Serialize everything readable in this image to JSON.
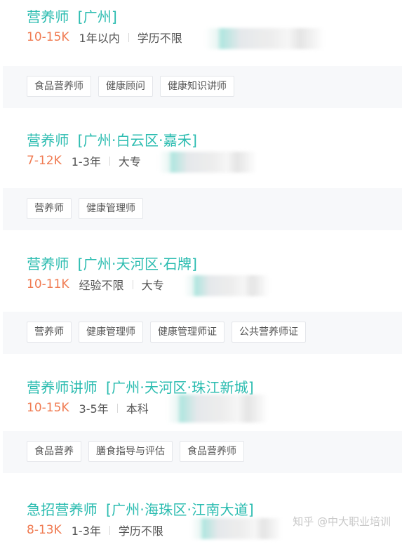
{
  "jobs": [
    {
      "title": "营养师",
      "location": "[广州]",
      "salary": "10-15K",
      "experience": "1年以内",
      "education": "学历不限",
      "tags": [
        "食品营养师",
        "健康顾问",
        "健康知识讲师"
      ]
    },
    {
      "title": "营养师",
      "location": "[广州·白云区·嘉禾]",
      "salary": "7-12K",
      "experience": "1-3年",
      "education": "大专",
      "tags": [
        "营养师",
        "健康管理师"
      ]
    },
    {
      "title": "营养师",
      "location": "[广州·天河区·石牌]",
      "salary": "10-11K",
      "experience": "经验不限",
      "education": "大专",
      "tags": [
        "营养师",
        "健康管理师",
        "健康管理师证",
        "公共营养师证"
      ]
    },
    {
      "title": "营养师讲师",
      "location": "[广州·天河区·珠江新城]",
      "salary": "10-15K",
      "experience": "3-5年",
      "education": "本科",
      "tags": [
        "食品营养",
        "膳食指导与评估",
        "食品营养师"
      ]
    },
    {
      "title": "急招营养师",
      "location": "[广州·海珠区·江南大道]",
      "salary": "8-13K",
      "experience": "1-3年",
      "education": "学历不限",
      "tags": []
    }
  ],
  "watermark": {
    "logo_icon": "zhihu-logo",
    "text": "知乎 @中大职业培训"
  },
  "colors": {
    "title": "#2bbcb0",
    "salary": "#f07b52",
    "tag_band": "#f7f8fa"
  }
}
